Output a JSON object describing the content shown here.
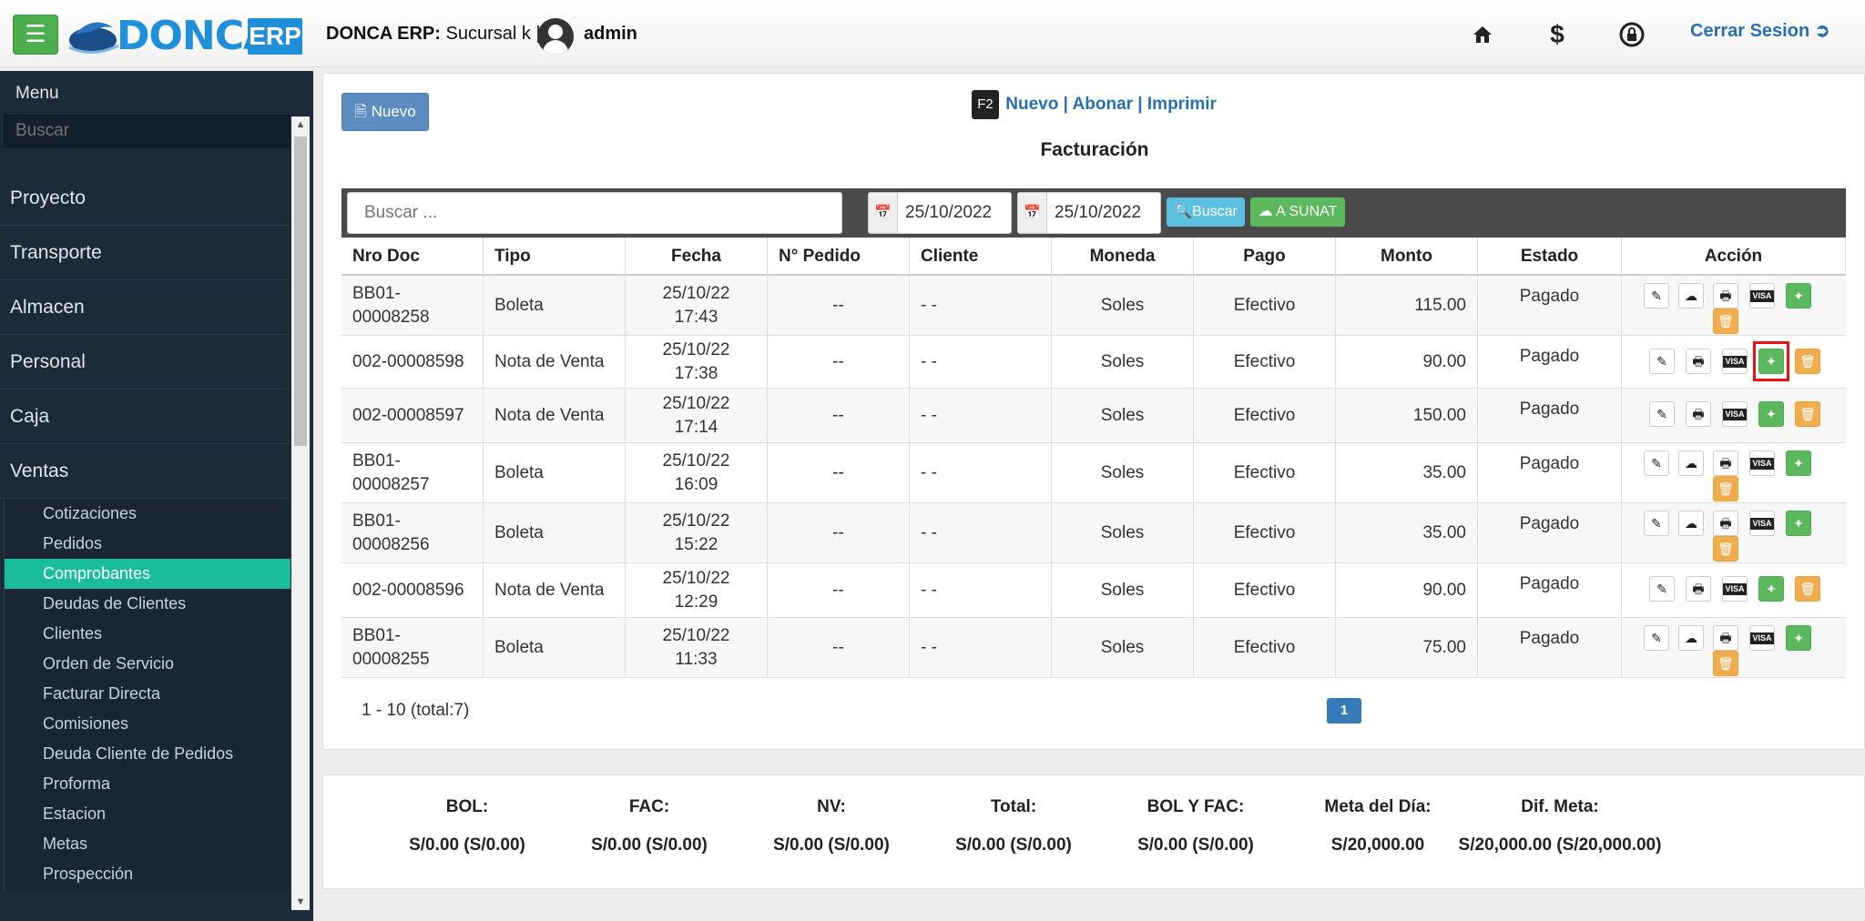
{
  "header": {
    "logo_text": "DONCA",
    "logo_badge": "ERP",
    "app_name": "DONCA ERP:",
    "branch": " Sucursal k |",
    "user": "admin",
    "logout": "Cerrar Sesion"
  },
  "sidebar": {
    "title": "Menu",
    "search_placeholder": "Buscar",
    "main_items": [
      "Proyecto",
      "Transporte",
      "Almacen",
      "Personal",
      "Caja",
      "Ventas"
    ],
    "sub_items": [
      "Cotizaciones",
      "Pedidos",
      "Comprobantes",
      "Deudas de Clientes",
      "Clientes",
      "Orden de Servicio",
      "Facturar Directa",
      "Comisiones",
      "Deuda Cliente de Pedidos",
      "Proforma",
      "Estacion",
      "Metas",
      "Prospección"
    ],
    "active_sub": "Comprobantes"
  },
  "main": {
    "nuevo_button": "Nuevo",
    "shortcut_key": "F2",
    "shortcut_nuevo": "Nuevo",
    "shortcut_abonar": "Abonar",
    "shortcut_imprimir": "Imprimir",
    "title": "Facturación",
    "search_placeholder": "Buscar ...",
    "date_from": "25/10/2022",
    "date_to": "25/10/2022",
    "buscar_button": "Buscar",
    "sunat_button": "A SUNAT",
    "columns": [
      "Nro Doc",
      "Tipo",
      "Fecha",
      "N° Pedido",
      "Cliente",
      "Moneda",
      "Pago",
      "Monto",
      "Estado",
      "Acción"
    ],
    "rows": [
      {
        "nro": "BB01-\n00008258",
        "tipo": "Boleta",
        "fecha": "25/10/22\n17:43",
        "pedido": "--",
        "cliente": "- -",
        "moneda": "Soles",
        "pago": "Efectivo",
        "monto": "115.00",
        "estado": "Pagado",
        "kind": "boleta"
      },
      {
        "nro": "002-00008598",
        "tipo": "Nota de Venta",
        "fecha": "25/10/22\n17:38",
        "pedido": "--",
        "cliente": "- -",
        "moneda": "Soles",
        "pago": "Efectivo",
        "monto": "90.00",
        "estado": "Pagado",
        "kind": "nota"
      },
      {
        "nro": "002-00008597",
        "tipo": "Nota de Venta",
        "fecha": "25/10/22\n17:14",
        "pedido": "--",
        "cliente": "- -",
        "moneda": "Soles",
        "pago": "Efectivo",
        "monto": "150.00",
        "estado": "Pagado",
        "kind": "nota"
      },
      {
        "nro": "BB01-\n00008257",
        "tipo": "Boleta",
        "fecha": "25/10/22\n16:09",
        "pedido": "--",
        "cliente": "- -",
        "moneda": "Soles",
        "pago": "Efectivo",
        "monto": "35.00",
        "estado": "Pagado",
        "kind": "boleta"
      },
      {
        "nro": "BB01-\n00008256",
        "tipo": "Boleta",
        "fecha": "25/10/22\n15:22",
        "pedido": "--",
        "cliente": "- -",
        "moneda": "Soles",
        "pago": "Efectivo",
        "monto": "35.00",
        "estado": "Pagado",
        "kind": "boleta"
      },
      {
        "nro": "002-00008596",
        "tipo": "Nota de Venta",
        "fecha": "25/10/22\n12:29",
        "pedido": "--",
        "cliente": "- -",
        "moneda": "Soles",
        "pago": "Efectivo",
        "monto": "90.00",
        "estado": "Pagado",
        "kind": "nota"
      },
      {
        "nro": "BB01-\n00008255",
        "tipo": "Boleta",
        "fecha": "25/10/22\n11:33",
        "pedido": "--",
        "cliente": "- -",
        "moneda": "Soles",
        "pago": "Efectivo",
        "monto": "75.00",
        "estado": "Pagado",
        "kind": "boleta"
      }
    ],
    "pagination_info": "1 - 10 (total:7)",
    "current_page": "1"
  },
  "summary": [
    {
      "label": "BOL:",
      "value": "S/0.00 (S/0.00)"
    },
    {
      "label": "FAC:",
      "value": "S/0.00 (S/0.00)"
    },
    {
      "label": "NV:",
      "value": "S/0.00 (S/0.00)"
    },
    {
      "label": "Total:",
      "value": "S/0.00 (S/0.00)"
    },
    {
      "label": "BOL Y FAC:",
      "value": "S/0.00 (S/0.00)"
    },
    {
      "label": "Meta del Día:",
      "value": "S/20,000.00"
    },
    {
      "label": "Dif. Meta:",
      "value": "S/20,000.00 (S/20,000.00)"
    }
  ],
  "icons": {
    "menu": "hamburger-icon",
    "home": "home-icon",
    "dollar": "dollar-icon",
    "lock": "lock-icon",
    "logout": "logout-icon",
    "edit": "pencil-icon",
    "cloud": "cloud-icon",
    "print": "printer-icon",
    "visa": "visa-icon",
    "magic": "magic-wand-icon",
    "delete": "trash-icon",
    "calendar": "calendar-icon",
    "search": "search-icon"
  },
  "highlighted_action": {
    "row": 1,
    "action": "magic-wand"
  }
}
